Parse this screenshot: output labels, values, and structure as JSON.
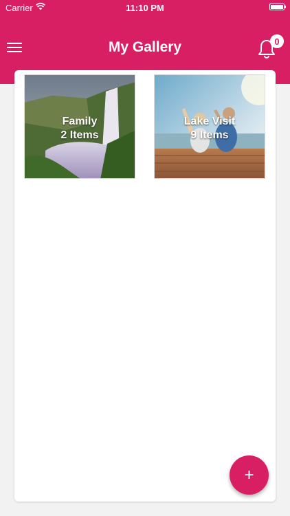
{
  "status_bar": {
    "carrier": "Carrier",
    "time": "11:10 PM"
  },
  "header": {
    "title": "My Gallery",
    "notification_count": "0"
  },
  "albums": [
    {
      "name": "Family",
      "count": "2 Items",
      "image": "waterfall-photo"
    },
    {
      "name": "Lake Visit",
      "count": "9 Items",
      "image": "lake-dock-photo"
    }
  ],
  "fab": {
    "label": "+"
  },
  "colors": {
    "accent": "#d91f63",
    "background": "#f2f2f2",
    "card": "#ffffff"
  }
}
